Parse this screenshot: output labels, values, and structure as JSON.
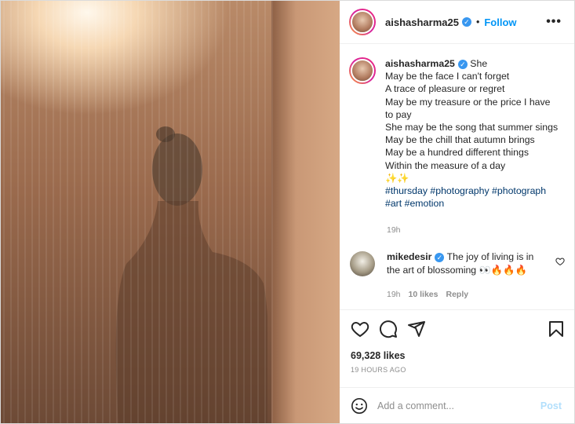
{
  "post": {
    "username": "aishasharma25",
    "follow_label": "Follow",
    "more_label": "•••",
    "caption": {
      "first_word": "She",
      "lines": [
        "May be the face I can't forget",
        "A trace of pleasure or regret",
        "May be my treasure or the price I have",
        "to pay",
        "She may be the song that summer sings",
        "May be the chill that autumn brings",
        "May be a hundred different things",
        "Within the measure of a day"
      ],
      "emoji": "✨✨",
      "hashtags_line1": "#thursday #photography #photograph",
      "hashtags_line2": "#art #emotion",
      "time": "19h"
    },
    "comment": {
      "username": "mikedesir",
      "text": "The joy of living is in the art of blossoming",
      "emoji": "👀🔥🔥🔥",
      "time": "19h",
      "likes": "10 likes",
      "reply": "Reply"
    },
    "likes": "69,328 likes",
    "posted_ago": "19 HOURS AGO",
    "comment_box": {
      "placeholder": "Add a comment...",
      "post_label": "Post"
    }
  }
}
